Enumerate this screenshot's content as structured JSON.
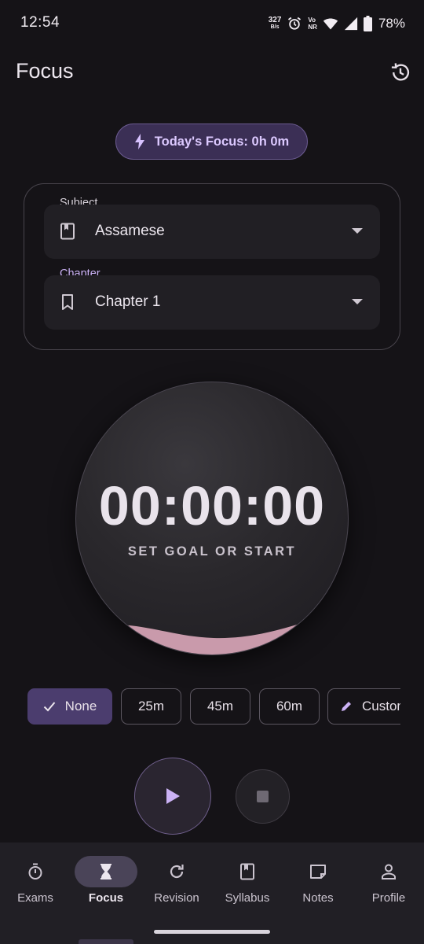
{
  "status_bar": {
    "time": "12:54",
    "net_speed_value": "327",
    "net_speed_unit": "B/s",
    "volte_top": "Vo",
    "volte_bottom": "NR",
    "battery_percent": "78%",
    "icons": [
      "alarm-icon",
      "wifi-icon",
      "signal-icon",
      "battery-icon"
    ]
  },
  "appbar": {
    "title": "Focus",
    "history_icon": "history-icon"
  },
  "today_focus": {
    "label": "Today's Focus: 0h 0m",
    "icon": "bolt-icon"
  },
  "selectors": {
    "subject_label": "Subject",
    "subject_value": "Assamese",
    "chapter_label": "Chapter",
    "chapter_value": "Chapter 1"
  },
  "timer": {
    "value": "00:00:00",
    "hint": "SET GOAL OR START",
    "progress_fill": 0.1
  },
  "goal_chips": [
    {
      "label": "None",
      "selected": true
    },
    {
      "label": "25m",
      "selected": false
    },
    {
      "label": "45m",
      "selected": false
    },
    {
      "label": "60m",
      "selected": false
    },
    {
      "label": "Custom",
      "selected": false
    }
  ],
  "controls": {
    "play_icon": "play-icon",
    "stop_icon": "stop-icon"
  },
  "nav": {
    "items": [
      {
        "label": "Exams",
        "icon": "timer-icon",
        "active": false
      },
      {
        "label": "Focus",
        "icon": "hourglass-icon",
        "active": true
      },
      {
        "label": "Revision",
        "icon": "refresh-icon",
        "active": false
      },
      {
        "label": "Syllabus",
        "icon": "book-icon",
        "active": false
      },
      {
        "label": "Notes",
        "icon": "note-icon",
        "active": false
      },
      {
        "label": "Profile",
        "icon": "person-icon",
        "active": false
      }
    ]
  },
  "colors": {
    "background": "#151317",
    "accent": "#4b3d6e",
    "accent_text": "#dcc9ff",
    "subject_label": "#d7d1da",
    "chapter_label": "#cbb2f5",
    "wave": "#c99aab"
  }
}
